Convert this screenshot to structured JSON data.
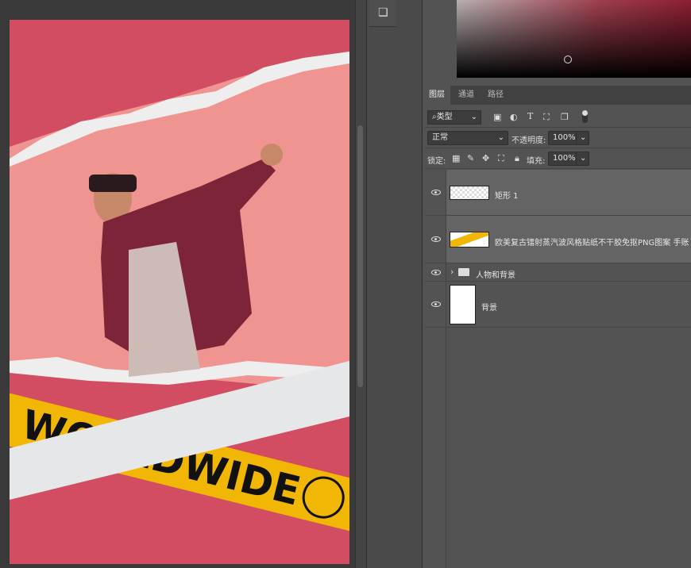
{
  "canvas": {
    "tape_text": "WORLDWIDE",
    "colors": {
      "background": "#d24d62",
      "paper": "#ef9490",
      "tape": "#f2b705",
      "band": "#e6e7e9"
    }
  },
  "panel": {
    "tabs": [
      {
        "label": "图层",
        "active": true
      },
      {
        "label": "通道"
      },
      {
        "label": "路径"
      }
    ],
    "filter": {
      "label": "类型"
    },
    "blend": {
      "mode": "正常",
      "opacity_label": "不透明度:",
      "opacity": "100%"
    },
    "lock": {
      "label": "锁定:",
      "fill_label": "填充:",
      "fill": "100%"
    },
    "layers": [
      {
        "name": "矩形 1",
        "visible": true,
        "selected": true
      },
      {
        "name": "欧美复古镭射蒸汽波风格贴纸不干胶免抠PNG图案 手账",
        "visible": true,
        "selected": true
      },
      {
        "name": "人物和背景",
        "type": "group",
        "visible": true
      },
      {
        "name": "背景",
        "visible": true
      }
    ]
  }
}
